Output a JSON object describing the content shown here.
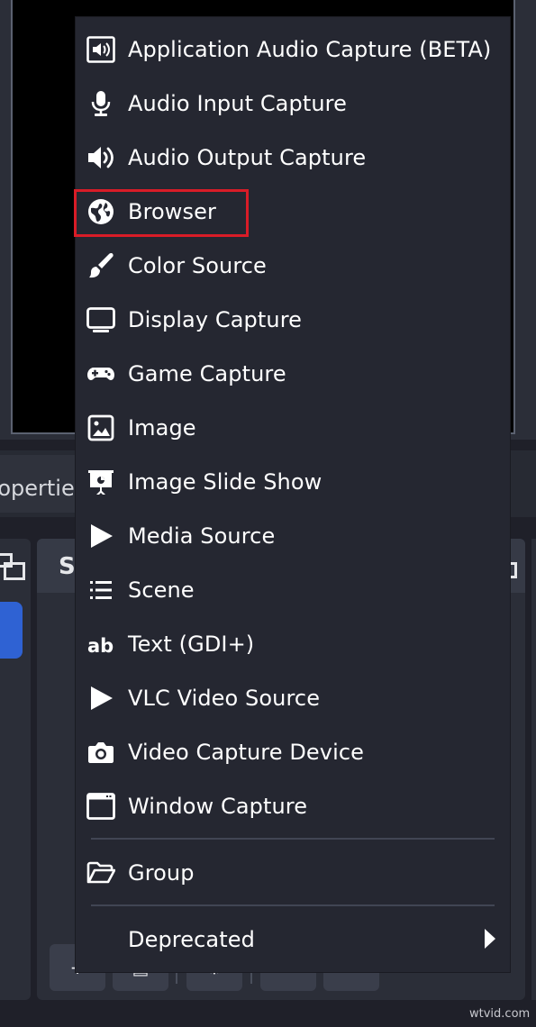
{
  "background": {
    "properties_tab_label": "ropertie",
    "sources_dock_title": "Sc",
    "colors": {
      "preview": "#000000",
      "panel": "#2b2e38",
      "accent": "#2f62d3"
    }
  },
  "context_menu": {
    "items": [
      {
        "label": "Application Audio Capture (BETA)",
        "icon": "speaker-box-icon"
      },
      {
        "label": "Audio Input Capture",
        "icon": "microphone-icon"
      },
      {
        "label": "Audio Output Capture",
        "icon": "speaker-icon"
      },
      {
        "label": "Browser",
        "icon": "globe-icon",
        "highlighted": true
      },
      {
        "label": "Color Source",
        "icon": "paint-brush-icon"
      },
      {
        "label": "Display Capture",
        "icon": "monitor-icon"
      },
      {
        "label": "Game Capture",
        "icon": "gamepad-icon"
      },
      {
        "label": "Image",
        "icon": "image-icon"
      },
      {
        "label": "Image Slide Show",
        "icon": "presentation-icon"
      },
      {
        "label": "Media Source",
        "icon": "play-icon"
      },
      {
        "label": "Scene",
        "icon": "list-icon"
      },
      {
        "label": "Text (GDI+)",
        "icon": "text-ab-icon"
      },
      {
        "label": "VLC Video Source",
        "icon": "play-icon"
      },
      {
        "label": "Video Capture Device",
        "icon": "camera-icon"
      },
      {
        "label": "Window Capture",
        "icon": "window-icon"
      }
    ],
    "group_item": {
      "label": "Group",
      "icon": "folder-open-icon"
    },
    "deprecated_item": {
      "label": "Deprecated",
      "icon": "chevron-right-icon"
    },
    "highlight_color": "#d91c27"
  },
  "watermark": "wtvid.com"
}
